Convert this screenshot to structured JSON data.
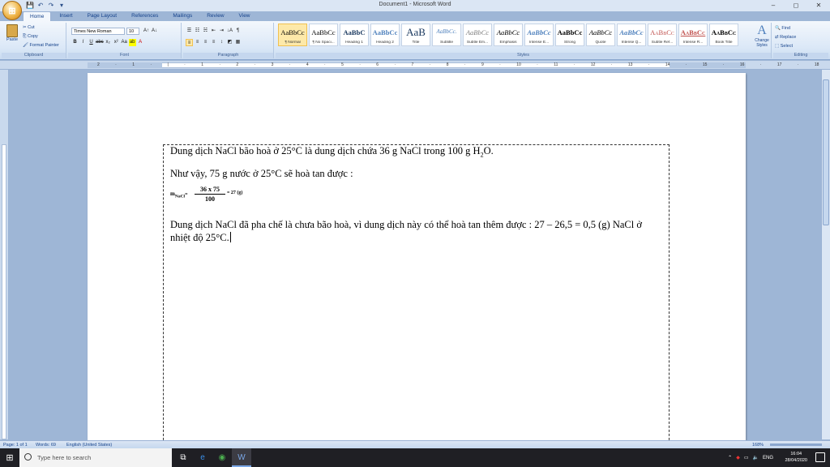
{
  "window": {
    "title": "Document1 - Microsoft Word",
    "min": "–",
    "max": "◻",
    "close": "✕"
  },
  "qat": [
    "💾",
    "↶",
    "↷",
    "▾"
  ],
  "tabs": [
    "Home",
    "Insert",
    "Page Layout",
    "References",
    "Mailings",
    "Review",
    "View"
  ],
  "clipboard": {
    "paste": "Paste",
    "cut": "Cut",
    "copy": "Copy",
    "format_painter": "Format Painter",
    "label": "Clipboard"
  },
  "font": {
    "name": "Times New Roman",
    "size": "10",
    "label": "Font",
    "bold": "B",
    "italic": "I",
    "underline": "U",
    "strike": "abc",
    "sub": "x₂",
    "sup": "x²",
    "case": "Aa",
    "highlight": "ab",
    "color": "A",
    "grow": "A↑",
    "shrink": "A↓"
  },
  "paragraph": {
    "label": "Paragraph",
    "bullets": "☰",
    "numbering": "☷",
    "multilevel": "☵",
    "decrease": "⇤",
    "increase": "⇥",
    "sort": "↓A",
    "show": "¶",
    "left": "≡",
    "center": "≡",
    "right": "≡",
    "justify": "≡",
    "spacing": "↕",
    "shading": "◩",
    "border": "▦"
  },
  "styles": {
    "label": "Styles",
    "items": [
      {
        "preview": "AaBbCc",
        "name": "¶ Normal"
      },
      {
        "preview": "AaBbCc",
        "name": "¶ No Spaci..."
      },
      {
        "preview": "AaBbC",
        "name": "Heading 1"
      },
      {
        "preview": "AaBbCc",
        "name": "Heading 2"
      },
      {
        "preview": "AaB",
        "name": "Title"
      },
      {
        "preview": "AaBbCc.",
        "name": "Subtitle"
      },
      {
        "preview": "AaBbCc",
        "name": "Subtle Em..."
      },
      {
        "preview": "AaBbCc",
        "name": "Emphasis"
      },
      {
        "preview": "AaBbCc",
        "name": "Intense E..."
      },
      {
        "preview": "AaBbCc",
        "name": "Strong"
      },
      {
        "preview": "AaBbCc",
        "name": "Quote"
      },
      {
        "preview": "AaBbCc",
        "name": "Intense Q..."
      },
      {
        "preview": "AaBbCc",
        "name": "Subtle Ref..."
      },
      {
        "preview": "AaBbCc",
        "name": "Intense R..."
      },
      {
        "preview": "AaBbCc",
        "name": "Book Title"
      }
    ],
    "change": "Change Styles"
  },
  "editing": {
    "find": "Find",
    "replace": "Replace",
    "select": "Select",
    "label": "Editing"
  },
  "ruler_nums": "2 · 1 · | · 1 · 2 · 3 · 4 · 5 · 6 · 7 · 8 · 9 · 10 · 11 · 12 · 13 · 14 · 15 · 16 · 17 · 18",
  "document": {
    "p1": "Dung dịch NaCl bão hoà ở 25°C là dung dịch chứa 36 g NaCl trong 100 g H",
    "p1_sub": "2",
    "p1_end": "O.",
    "p2": "Như vậy, 75 g nước ở 25°C sẽ hoà tan được :",
    "formula_m": "m",
    "formula_sub": "NaCl",
    "formula_eq": "=",
    "formula_num": "36 x 75",
    "formula_den": "100",
    "formula_result": "= 27 (g)",
    "p3": "Dung dịch NaCl đã pha chế là chưa bão hoà, vì dung dịch này có thể hoà tan thêm được : 27 – 26,5 = 0,5 (g) NaCl ở",
    "p4": "nhiệt độ 25°C."
  },
  "status": {
    "page": "Page: 1 of 1",
    "words": "Words: 69",
    "lang": "English (United States)",
    "zoom": "168%"
  },
  "taskbar": {
    "search_placeholder": "Type here to search",
    "lang": "ENG",
    "time": "16:04",
    "date": "28/04/2020"
  }
}
